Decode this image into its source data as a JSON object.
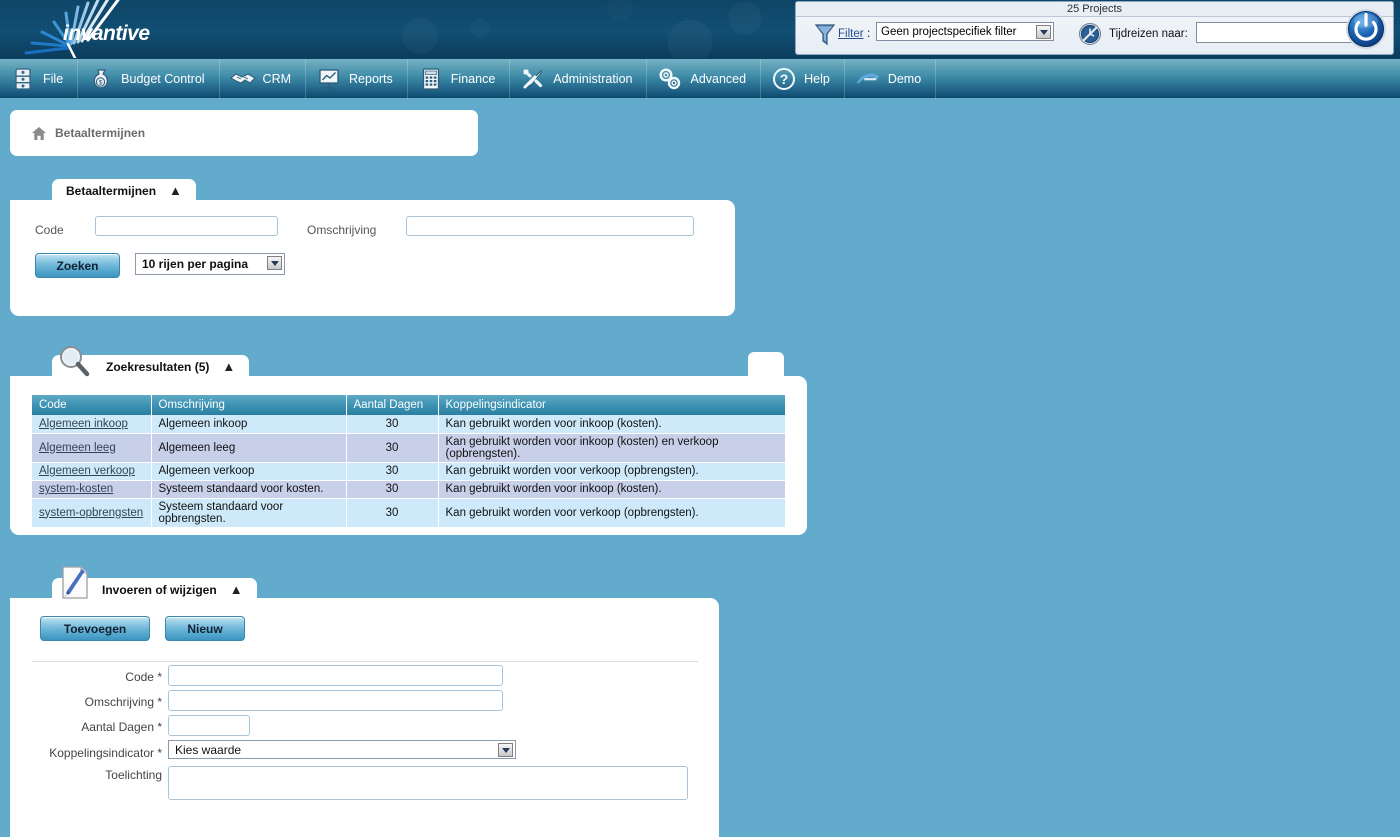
{
  "app": {
    "logo_text": "invantive"
  },
  "filterbar": {
    "projects_count": "25 Projects",
    "filter_link": "Filter",
    "filter_colon": ":",
    "filter_value": "Geen projectspecifiek filter",
    "timetravel_label": "Tijdreizen naar:",
    "timetravel_value": "",
    "timetravel_placeholder": "",
    "funnel_icon": "funnel-icon",
    "clock_icon": "clock-icon",
    "power_icon": "power-icon"
  },
  "menu": {
    "items": [
      {
        "label": "File",
        "icon": "cabinet-icon"
      },
      {
        "label": "Budget Control",
        "icon": "money-bag-icon"
      },
      {
        "label": "CRM",
        "icon": "handshake-icon"
      },
      {
        "label": "Reports",
        "icon": "presentation-chart-icon"
      },
      {
        "label": "Finance",
        "icon": "calculator-icon"
      },
      {
        "label": "Administration",
        "icon": "tools-icon"
      },
      {
        "label": "Advanced",
        "icon": "gears-icon"
      },
      {
        "label": "Help",
        "icon": "question-mark-icon"
      },
      {
        "label": "Demo",
        "icon": "invantive-logo-icon"
      }
    ]
  },
  "breadcrumb": {
    "home_icon": "home-icon",
    "label": "Betaaltermijnen"
  },
  "search_panel": {
    "title": "Betaaltermijnen",
    "collapse_icon": "chevron-up-icon",
    "code_label": "Code",
    "code_value": "",
    "omschrijving_label": "Omschrijving",
    "omschrijving_value": "",
    "search_button": "Zoeken",
    "rows_per_page": "10 rijen per pagina"
  },
  "results_panel": {
    "title": "Zoekresultaten (5)",
    "icon": "magnifier-icon",
    "collapse_icon": "chevron-up-icon",
    "columns": [
      "Code",
      "Omschrijving",
      "Aantal Dagen",
      "Koppelingsindicator"
    ],
    "rows": [
      {
        "code": "Algemeen inkoop",
        "omschrijving": "Algemeen inkoop",
        "aantal_dagen": "30",
        "koppelingsindicator": "Kan gebruikt worden voor inkoop (kosten)."
      },
      {
        "code": "Algemeen leeg",
        "omschrijving": "Algemeen leeg",
        "aantal_dagen": "30",
        "koppelingsindicator": "Kan gebruikt worden voor inkoop (kosten) en verkoop (opbrengsten)."
      },
      {
        "code": "Algemeen verkoop",
        "omschrijving": "Algemeen verkoop",
        "aantal_dagen": "30",
        "koppelingsindicator": "Kan gebruikt worden voor verkoop (opbrengsten)."
      },
      {
        "code": "system-kosten",
        "omschrijving": "Systeem standaard voor kosten.",
        "aantal_dagen": "30",
        "koppelingsindicator": "Kan gebruikt worden voor inkoop (kosten)."
      },
      {
        "code": "system-opbrengsten",
        "omschrijving": "Systeem standaard voor opbrengsten.",
        "aantal_dagen": "30",
        "koppelingsindicator": "Kan gebruikt worden voor verkoop (opbrengsten)."
      }
    ]
  },
  "edit_panel": {
    "title": "Invoeren of wijzigen",
    "icon": "document-pencil-icon",
    "collapse_icon": "chevron-up-icon",
    "add_button": "Toevoegen",
    "new_button": "Nieuw",
    "fields": {
      "code_label": "Code *",
      "code_value": "",
      "omschrijving_label": "Omschrijving *",
      "omschrijving_value": "",
      "aantal_dagen_label": "Aantal Dagen *",
      "aantal_dagen_value": "",
      "koppelingsindicator_label": "Koppelingsindicator *",
      "koppelingsindicator_value": "Kies waarde",
      "toelichting_label": "Toelichting",
      "toelichting_value": ""
    }
  },
  "colors": {
    "background": "#63abcd",
    "banner": "#0f4a6b",
    "menubar_top": "#76b2c5",
    "menubar_bottom": "#0d4a68",
    "table_header": "#3e93b4",
    "row_odd": "#cde9fa",
    "row_even": "#c8cfe9",
    "link": "#2a4f8f"
  }
}
